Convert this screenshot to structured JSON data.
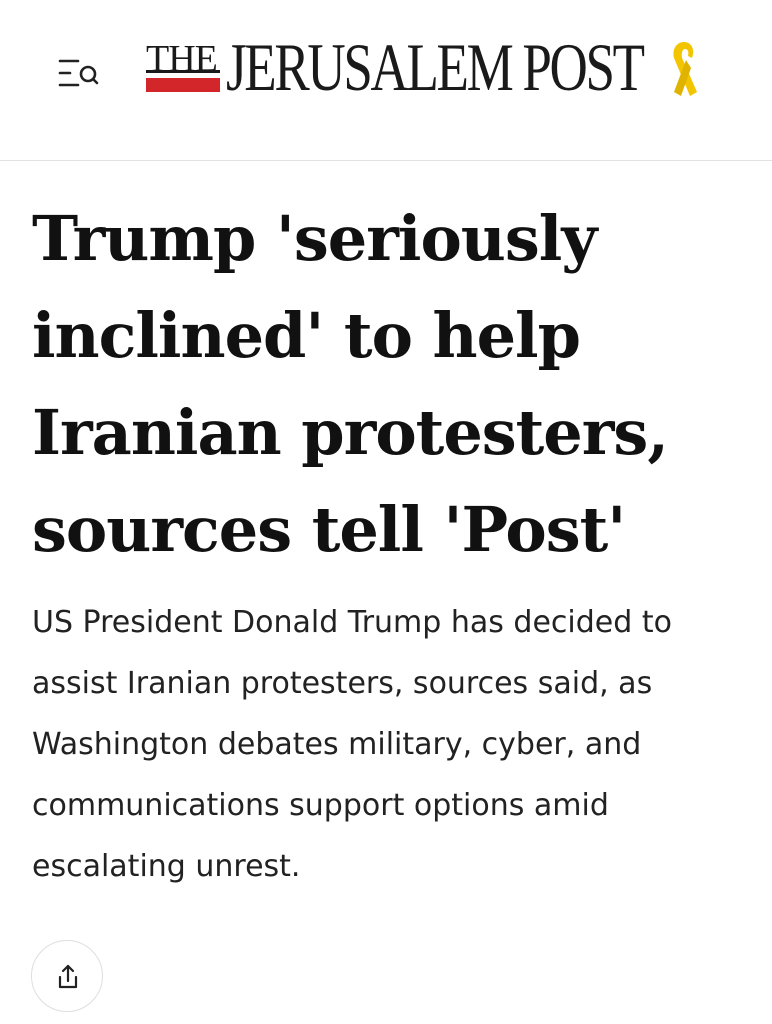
{
  "header": {
    "menu_icon": "menu-search-icon",
    "logo": {
      "the": "THE",
      "name": "JERUSALEM POST",
      "ribbon_icon": "yellow-ribbon-icon",
      "accent_color": "#d2262b",
      "ribbon_color": "#f2c500"
    }
  },
  "article": {
    "headline": "Trump 'seriously inclined' to help Iranian protesters, sources tell 'Post'",
    "summary": "US President Donald Trump has decided to assist Iranian protesters, sources said, as Washington debates military, cyber, and communications support options amid escalating unrest."
  },
  "actions": {
    "share_icon": "share-icon"
  }
}
